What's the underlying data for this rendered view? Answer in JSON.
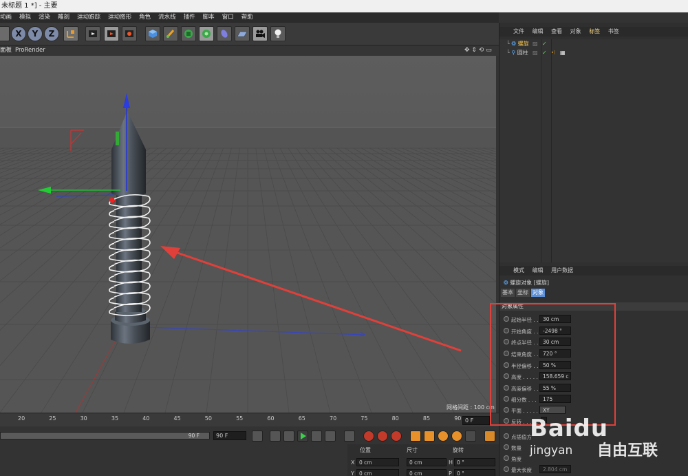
{
  "window": {
    "title": "未标题 1 *] - 主要"
  },
  "menu": [
    "动画",
    "模拟",
    "渲染",
    "雕刻",
    "运动跟踪",
    "运动图形",
    "角色",
    "流水线",
    "插件",
    "脚本",
    "窗口",
    "帮助"
  ],
  "toolbar": {
    "axes": [
      "X",
      "Y",
      "Z"
    ]
  },
  "viewport_header": {
    "left": "面板",
    "renderer": "ProRender",
    "grid_info": "网格间距 : 100 cm"
  },
  "object_manager": {
    "tabs": [
      "文件",
      "编辑",
      "查看",
      "对象",
      "标签",
      "书签"
    ],
    "active_tab": "标签",
    "objects": [
      {
        "name": "螺旋"
      },
      {
        "name": "圆柱"
      }
    ]
  },
  "attributes": {
    "tabs": [
      "模式",
      "编辑",
      "用户数据"
    ],
    "object_title": "螺旋对象 [螺旋]",
    "subtabs": [
      "基本",
      "坐标",
      "对象"
    ],
    "active_subtab": "对象",
    "section": "对象属性",
    "fields": [
      {
        "label": "起始半径 . .",
        "value": "30 cm"
      },
      {
        "label": "开始角度 . .",
        "value": "-2498 °"
      },
      {
        "label": "终点半径 . .",
        "value": "30 cm"
      },
      {
        "label": "结束角度 . .",
        "value": "720 °"
      },
      {
        "label": "半径偏移 . .",
        "value": "50 %"
      },
      {
        "label": "高度 . . . . .",
        "value": "158.659 c"
      },
      {
        "label": "高度偏移 . .",
        "value": "55 %"
      },
      {
        "label": "细分数 . . .",
        "value": "175"
      },
      {
        "label": "平面 . . . . .",
        "value": "XY"
      },
      {
        "label": "反转 . . . . .",
        "value": ""
      }
    ],
    "lower_fields": [
      {
        "label": "点插值方",
        "value": ""
      },
      {
        "label": "数量",
        "value": ""
      },
      {
        "label": "角度",
        "value": ""
      },
      {
        "label": "最大长度",
        "value": "2.804 cm"
      }
    ]
  },
  "timeline": {
    "ticks": [
      "20",
      "25",
      "30",
      "35",
      "40",
      "45",
      "50",
      "55",
      "60",
      "65",
      "70",
      "75",
      "80",
      "85",
      "90"
    ],
    "current_frame": "0 F",
    "end_frame_a": "90 F",
    "end_frame_b": "90 F"
  },
  "coordinates": {
    "headers": [
      "位置",
      "尺寸",
      "旋转"
    ],
    "rows": [
      {
        "axis": "X",
        "pos": "0 cm",
        "size": "0 cm",
        "rot_axis": "H",
        "rot": "0 °"
      },
      {
        "axis": "Y",
        "pos": "0 cm",
        "size": "0 cm",
        "rot_axis": "P",
        "rot": "0 °"
      }
    ]
  },
  "watermark": {
    "brand": "Baidu",
    "sub": "jingyan",
    "site": "自由互联"
  },
  "colors": {
    "annotation_red": "#e0403a",
    "viewport_bg": "#545454",
    "accent_tab": "#5c8fd6"
  }
}
